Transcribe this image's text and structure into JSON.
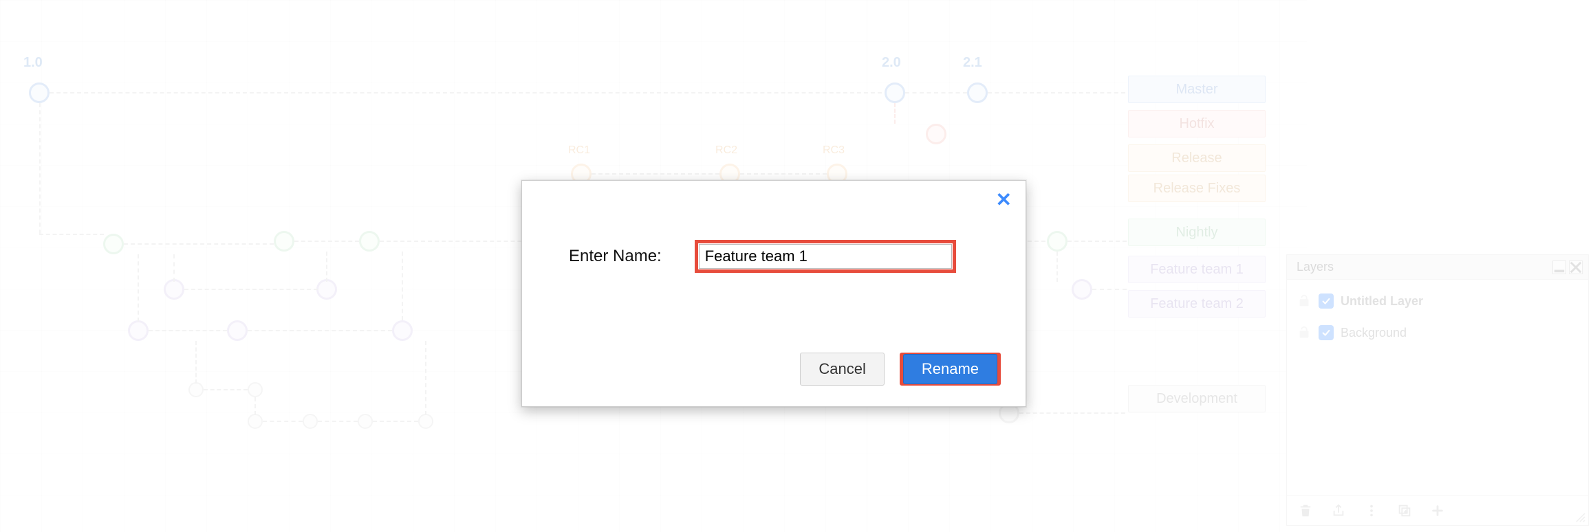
{
  "tags": [
    {
      "text": "1.0",
      "color": "blue"
    },
    {
      "text": "2.0",
      "color": "blue"
    },
    {
      "text": "2.1",
      "color": "blue"
    },
    {
      "text": "RC1",
      "color": "orange"
    },
    {
      "text": "RC2",
      "color": "orange"
    },
    {
      "text": "RC3",
      "color": "orange"
    }
  ],
  "branches": [
    {
      "label": "Master",
      "color": "blue"
    },
    {
      "label": "Hotfix",
      "color": "red"
    },
    {
      "label": "Release",
      "color": "orange"
    },
    {
      "label": "Release Fixes",
      "color": "orange2"
    },
    {
      "label": "Nightly",
      "color": "green"
    },
    {
      "label": "Feature team 1",
      "color": "purple"
    },
    {
      "label": "Feature team 2",
      "color": "purple"
    },
    {
      "label": "Development",
      "color": "gray"
    }
  ],
  "layers_panel": {
    "title": "Layers",
    "items": [
      {
        "label": "Untitled Layer",
        "active": true,
        "checked": true
      },
      {
        "label": "Background",
        "active": false,
        "checked": true
      }
    ]
  },
  "modal": {
    "label": "Enter Name:",
    "input_value": "Feature team 1",
    "cancel": "Cancel",
    "confirm": "Rename"
  }
}
